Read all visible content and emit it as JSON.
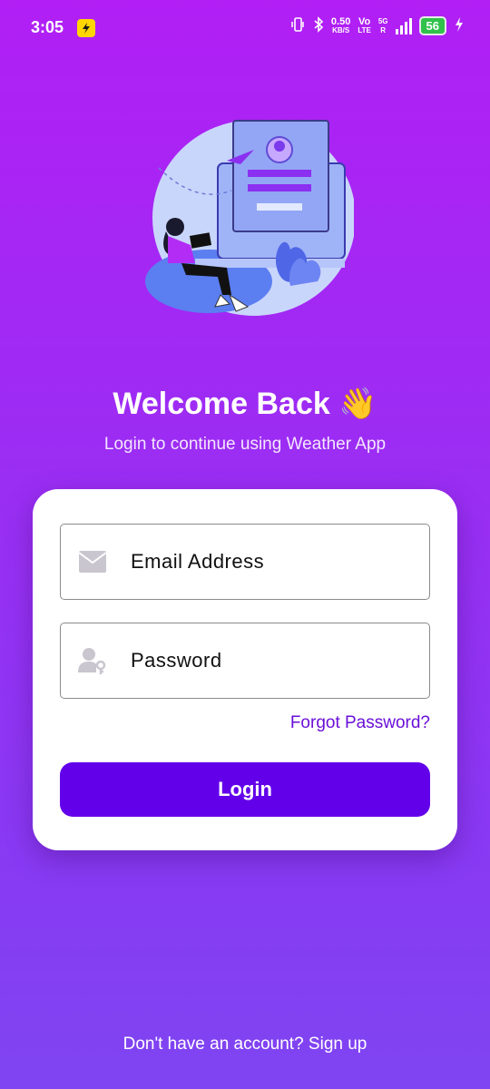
{
  "status_bar": {
    "time": "3:05",
    "net_speed": "0.50",
    "net_unit": "KB/S",
    "volte": "Vo",
    "lte": "LTE",
    "network": "5G",
    "roaming": "R",
    "battery": "56"
  },
  "welcome": {
    "title": "Welcome Back 👋",
    "subtitle": "Login to continue using Weather App"
  },
  "form": {
    "email_placeholder": "Email Address",
    "password_placeholder": "Password",
    "forgot_label": "Forgot Password?",
    "login_label": "Login"
  },
  "footer": {
    "prompt": "Don't have an account? Sign up"
  },
  "colors": {
    "accent": "#6200ea",
    "link": "#6a0fd8",
    "bg_top": "#b11ff5",
    "bg_bottom": "#7f45f2"
  },
  "icons": [
    "app-badge-icon",
    "vibrate-icon",
    "bluetooth-icon",
    "signal-icon",
    "charging-icon",
    "mail-icon",
    "user-key-icon"
  ]
}
